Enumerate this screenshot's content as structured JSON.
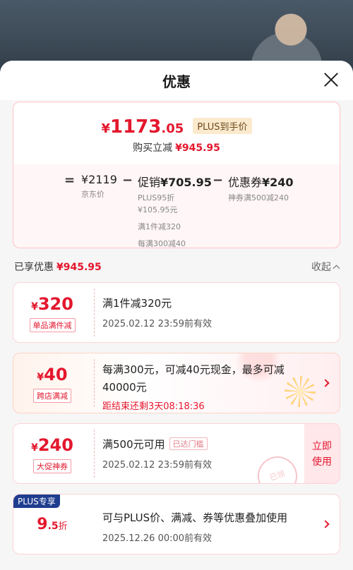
{
  "header": {
    "title": "优惠"
  },
  "summary": {
    "currency": "¥",
    "price_int": "1173",
    "price_dec": ".05",
    "plus_tag": "PLUS到手价",
    "reduce_label": "购买立减",
    "reduce_amount": "¥945.95"
  },
  "breakdown": {
    "eq": "=",
    "minus": "−",
    "jd_price": "¥2119",
    "jd_label": "京东价",
    "promo_label": "促销",
    "promo_amount": "¥705.95",
    "promo_lines": [
      "PLUS95折",
      "¥105.95元",
      "满1件减320",
      "每满300减40"
    ],
    "coupon_label": "优惠券",
    "coupon_amount": "¥240",
    "coupon_sub": "神券满500减240"
  },
  "enjoyed": {
    "label": "已享优惠",
    "amount": "¥945.95",
    "collapse_label": "收起"
  },
  "coupons": [
    {
      "currency": "¥",
      "value": "320",
      "tag": "单品满件减",
      "desc": "满1件减320元",
      "date": "2025.02.12 23:59前有效"
    },
    {
      "currency": "¥",
      "value": "40",
      "tag": "跨店满减",
      "desc_line1": "每满300元，可减40元现金，最多可减",
      "desc_line2": "40000元",
      "countdown": "距结束还剩3天08:18:36"
    },
    {
      "currency": "¥",
      "value": "240",
      "tag": "大促神券",
      "desc": "满500元可用",
      "reached": "已达门槛",
      "date": "2025.02.12 23:59前有效",
      "action_line1": "立即",
      "action_line2": "使用",
      "stamp": "已领"
    },
    {
      "badge": "PLUS专享",
      "value_int": "9",
      "value_dec": ".5",
      "unit": "折",
      "desc": "可与PLUS价、满减、券等优惠叠加使用",
      "date": "2025.12.26 00:00前有效"
    }
  ],
  "colors": {
    "accent": "#e4172d",
    "plus_badge": "#1f3d8f",
    "plus_tag_bg": "#fbeacd"
  }
}
